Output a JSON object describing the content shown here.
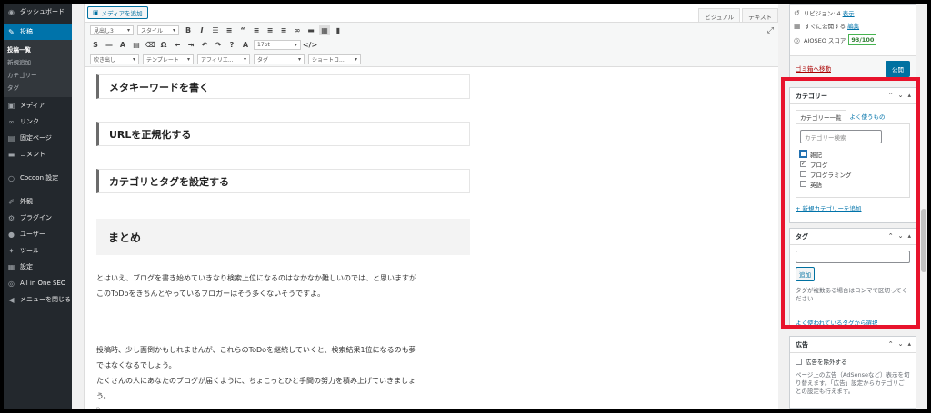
{
  "sidebar": {
    "items": [
      {
        "label": "ダッシュボード",
        "icon": "dashboard-icon",
        "glyph": "◉"
      },
      {
        "label": "投稿",
        "icon": "pin-icon",
        "glyph": "✎",
        "active": true
      }
    ],
    "sub": [
      {
        "label": "投稿一覧",
        "current": true
      },
      {
        "label": "新規追加"
      },
      {
        "label": "カテゴリー"
      },
      {
        "label": "タグ"
      }
    ],
    "more": [
      {
        "label": "メディア",
        "icon": "media-icon",
        "glyph": "▣"
      },
      {
        "label": "リンク",
        "icon": "link-icon",
        "glyph": "∞"
      },
      {
        "label": "固定ページ",
        "icon": "page-icon",
        "glyph": "▤"
      },
      {
        "label": "コメント",
        "icon": "comment-icon",
        "glyph": "▬"
      }
    ],
    "cocoon": {
      "label": "Cocoon 設定",
      "icon": "cocoon-icon",
      "glyph": "○"
    },
    "tail": [
      {
        "label": "外観",
        "icon": "brush-icon",
        "glyph": "✐"
      },
      {
        "label": "プラグイン",
        "icon": "plugin-icon",
        "glyph": "⚙"
      },
      {
        "label": "ユーザー",
        "icon": "user-icon",
        "glyph": "●"
      },
      {
        "label": "ツール",
        "icon": "tool-icon",
        "glyph": "✦"
      },
      {
        "label": "設定",
        "icon": "settings-icon",
        "glyph": "▦"
      },
      {
        "label": "All in One SEO",
        "icon": "seo-icon",
        "glyph": "◎"
      },
      {
        "label": "メニューを閉じる",
        "icon": "collapse-icon",
        "glyph": "◀"
      }
    ]
  },
  "editor": {
    "media_button": "メディアを追加",
    "tabs": [
      "ビジュアル",
      "テキスト"
    ],
    "toolbar": {
      "format_select": "見出し3",
      "style_select": "スタイル",
      "fontsize_select": "17pt",
      "row3": [
        "吹き出し",
        "テンプレート",
        "アフィリエ...",
        "タグ",
        "ショートコ..."
      ]
    },
    "headings": [
      "メタキーワードを書く",
      "URLを正規化する",
      "カテゴリとタグを設定する"
    ],
    "section_title": "まとめ",
    "paragraphs": [
      "とはいえ、ブログを書き始めていきなり検索上位になるのはなかなか難しいのでは、と思いますが",
      "このToDoをきちんとやっているブロガーはそう多くないそうですよ。",
      "投稿時、少し面倒かもしれませんが、これらのToDoを継続していくと、検索結果1位になるのも夢",
      "ではなくなるでしょう。",
      "たくさんの人にあなたのブログが届くように、ちょこっとひと手間の努力を積み上げていきましょ",
      "う。",
      "p"
    ]
  },
  "publish": {
    "revisions_label": "リビジョン: 4",
    "revisions_link": "表示",
    "schedule_label": "すぐに公開する",
    "schedule_link": "編集",
    "seo_label": "AIOSEO スコア",
    "seo_score": "93/100",
    "trash": "ゴミ箱へ移動",
    "publish_button": "公開"
  },
  "category_box": {
    "title": "カテゴリー",
    "tab_all": "カテゴリー一覧",
    "tab_popular": "よく使うもの",
    "search_placeholder": "カテゴリー検索",
    "items": [
      {
        "label": "雑記",
        "checked": false
      },
      {
        "label": "ブログ",
        "checked": true
      },
      {
        "label": "プログラミング",
        "checked": false
      },
      {
        "label": "英語",
        "checked": false
      }
    ],
    "add_new": "+ 新規カテゴリーを追加"
  },
  "tag_box": {
    "title": "タグ",
    "add_button": "追加",
    "note": "タグが複数ある場合はコンマで区切ってください",
    "popular_link": "よく使われているタグから選択"
  },
  "ad_box": {
    "title": "広告",
    "checkbox_label": "広告を除外する",
    "note": "ページ上の広告（AdSenseなど）表示を切り替えます。「広告」設定からカテゴリごとの設定も行えます。"
  },
  "colors": {
    "accent": "#0073aa",
    "highlight": "#e8132c",
    "sidebar_bg": "#23282d"
  }
}
